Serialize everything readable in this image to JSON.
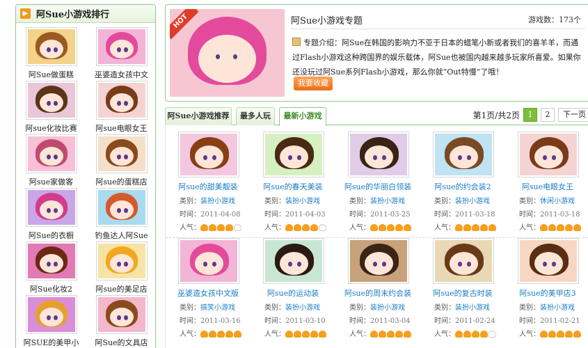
{
  "sidebar": {
    "title": "阿Sue小游戏排行",
    "items": [
      {
        "label": "阿Sue做蛋糕",
        "bg": "#f3d28a",
        "hair": "#9a5a1e"
      },
      {
        "label": "巫婆造女孩中文",
        "bg": "#f2b5d6",
        "hair": "#e44a9c"
      },
      {
        "label": "阿sue化妆比赛",
        "bg": "#e9c6d8",
        "hair": "#5c3418"
      },
      {
        "label": "阿sue电眼女王",
        "bg": "#f5d3d3",
        "hair": "#7a3b1a"
      },
      {
        "label": "阿sue家做客",
        "bg": "#f7c0d7",
        "hair": "#c04a6e"
      },
      {
        "label": "阿sue的蛋糕店",
        "bg": "#f6dfc8",
        "hair": "#8a4a1c"
      },
      {
        "label": "阿Sue的衣橱",
        "bg": "#c9a6e6",
        "hair": "#d43b8c"
      },
      {
        "label": "钓鱼达人阿Sue",
        "bg": "#a9dbf0",
        "hair": "#d45a2c"
      },
      {
        "label": "阿Sue化妆2",
        "bg": "#e27ab5",
        "hair": "#6a2a12"
      },
      {
        "label": "阿sue的美足店",
        "bg": "#f8e3a6",
        "hair": "#f0a820"
      },
      {
        "label": "阿SUE的美甲小",
        "bg": "#d98ed8",
        "hair": "#e6a030"
      },
      {
        "label": "阿Sue的文具店",
        "bg": "#f3b8cc",
        "hair": "#8a4a1c"
      }
    ]
  },
  "feature": {
    "hot_label": "HOT",
    "title": "阿Sue小游戏专题",
    "count": "游戏数：173个",
    "intro": "专题介绍：阿Sue在韩国的影响力不亚于日本的蜡笔小新或者我们的喜羊羊，而通过Flash小游戏这种跨国界的娱乐载体，阿Sue也被国内越来越多玩家所喜爱。如果你还没玩过阿Sue系列Flash小游戏，那么你就“Out特慢”了哦！",
    "fav_button": "我要收藏"
  },
  "tabs": [
    "阿Sue小游戏推荐",
    "最多人玩",
    "最新小游戏"
  ],
  "pager": {
    "info": "第1页/共2页",
    "pages": [
      "1",
      "2"
    ],
    "next": "下一页"
  },
  "labels": {
    "category": "类别：",
    "time": "时间：",
    "popularity": "人气："
  },
  "games": [
    {
      "name": "阿sue的甜美靓装",
      "category": "装扮小游戏",
      "date": "2011-04-08",
      "stars": 4,
      "bg": "#f3c8de",
      "hair": "#8a3e14"
    },
    {
      "name": "阿sue的春天美装",
      "category": "装扮小游戏",
      "date": "2011-04-03",
      "stars": 4,
      "bg": "#d6f0c2",
      "hair": "#4a2a12"
    },
    {
      "name": "阿sue的华丽白领装",
      "category": "装扮小游戏",
      "date": "2011-03-25",
      "stars": 5,
      "bg": "#e0cce6",
      "hair": "#3a2216"
    },
    {
      "name": "阿sue的约会装2",
      "category": "装扮小游戏",
      "date": "2011-03-18",
      "stars": 5,
      "bg": "#bfe3f2",
      "hair": "#7a4a22"
    },
    {
      "name": "阿sue电眼女王",
      "category": "休闲小游戏",
      "date": "2011-03-18",
      "stars": 5,
      "bg": "#f5d3d3",
      "hair": "#7a3b1a"
    },
    {
      "name": "巫婆造女孩中文版",
      "category": "搞笑小游戏",
      "date": "2011-03-16",
      "stars": 5,
      "bg": "#f2b5d6",
      "hair": "#e44a9c"
    },
    {
      "name": "阿sue的运动装",
      "category": "装扮小游戏",
      "date": "2011-03-10",
      "stars": 5,
      "bg": "#c8e6d4",
      "hair": "#2a1a12"
    },
    {
      "name": "阿sue的周末约会装",
      "category": "装扮小游戏",
      "date": "2011-03-04",
      "stars": 5,
      "bg": "#c8a27a",
      "hair": "#3a2414"
    },
    {
      "name": "阿sue的复古时装",
      "category": "装扮小游戏",
      "date": "2011-02-24",
      "stars": 4,
      "bg": "#e8d8b4",
      "hair": "#6a3a18"
    },
    {
      "name": "阿sue的美甲店3",
      "category": "装扮小游戏",
      "date": "2011-02-21",
      "stars": 5,
      "bg": "#f7d6c2",
      "hair": "#5a2e12"
    }
  ]
}
